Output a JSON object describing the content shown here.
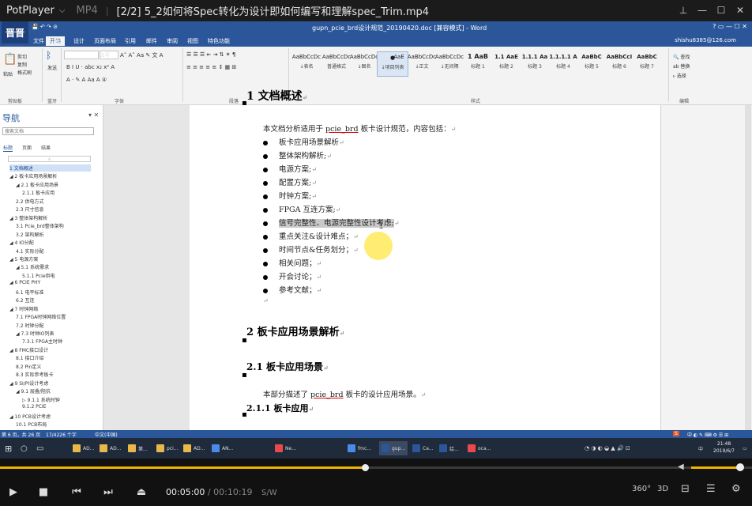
{
  "player": {
    "app_name": "PotPlayer",
    "format": "MP4",
    "file_title": "[2/2] 5_2如何将Spec转化为设计即如何编写和理解spec_Trim.mp4",
    "time_current": "00:05:00",
    "time_separator": "/",
    "time_total": "00:10:19",
    "speed_label": "S/W",
    "label_360": "360°",
    "label_3d": "3D",
    "progress_fraction": 0.485,
    "volume_fraction": 0.92
  },
  "word": {
    "logo": "晋晋",
    "doc_title": "gupn_pcie_brd设计规范_20190420.doc [兼容模式] - Word",
    "user": "shishu8385@126.com",
    "tabs": [
      "文件",
      "开始",
      "插入",
      "设计",
      "页面布局",
      "引用",
      "邮件",
      "审阅",
      "视图",
      "特色功能"
    ],
    "ribbon": {
      "paste": "粘贴",
      "cut": "剪切",
      "copy": "复制",
      "format_painter": "格式刷",
      "send": "发送",
      "font_size": "五号",
      "clipboard_group": "剪贴板",
      "blue_group": "蓝牙",
      "font_group": "字体",
      "para_group": "段落",
      "styles_group": "样式",
      "edit_group": "编辑",
      "find": "查找",
      "replace": "替换",
      "select": "选择",
      "styles": [
        {
          "preview": "AaBbCcDc",
          "name": "↓表名"
        },
        {
          "preview": "AaBbCcDc",
          "name": "普通格式"
        },
        {
          "preview": "AaBbCcDc",
          "name": "↓图名"
        },
        {
          "preview": "●",
          "name": "↓项目列表"
        },
        {
          "preview": "AaE",
          "name": ""
        },
        {
          "preview": "AaBbCcDc",
          "name": "↓正文"
        },
        {
          "preview": "AaBbCcDc",
          "name": "↓无间隔"
        },
        {
          "preview": "1 AaB",
          "name": "标题 1"
        },
        {
          "preview": "1.1 AaE",
          "name": "标题 2"
        },
        {
          "preview": "1.1.1 Aa",
          "name": "标题 3"
        },
        {
          "preview": "1.1.1.1 A",
          "name": "标题 4"
        },
        {
          "preview": "AaBbC",
          "name": "标题 5"
        },
        {
          "preview": "AaBbCcI",
          "name": "标题 6"
        },
        {
          "preview": "AaBbC",
          "name": "标题 7"
        }
      ]
    },
    "nav": {
      "title": "导航",
      "search_placeholder": "搜索文档",
      "tab_headings": "标题",
      "tab_pages": "页面",
      "tab_results": "结果",
      "items": [
        "1 文档概述",
        "◢ 2 板卡应用场景解析",
        "◢ 2.1 板卡应用场景",
        "2.1.1 板卡应用",
        "2.2 供电方式",
        "2.3 尺寸信息",
        "◢ 3 整体架构解析",
        "3.1 Pcie_brd整体架构",
        "3.2 架构解析",
        "◢ 4 IO分配",
        "4.1 实际分配",
        "◢ 5 电源方案",
        "◢ 5.1 系统需求",
        "5.1.1 Pcie供电",
        "◢ 6 PCIE PHY",
        "6.1 电平标准",
        "6.2 互连",
        "◢ 7 时钟网络",
        "7.1 FPGA时钟网络位置",
        "7.2 时钟分配",
        "◢ 7.3 时钟IO列表",
        "7.3.1 FPGA主时钟",
        "◢ 8 FMC接口设计",
        "8.1 接口介绍",
        "8.2 Pin定义",
        "8.3 实际参考板卡",
        "◢ 9 SI/PI设计考虑",
        "◢ 9.1 层叠/阻抗",
        "▷ 9.1.1 系统时钟",
        "9.1.2 PCIE",
        "◢ 10 PCB设计考虑",
        "10.1 PCB布局",
        "10.2 层叠",
        "10.3 设计规则"
      ]
    },
    "document": {
      "h1_overview": "1 文档概述",
      "intro_before": "本文档分析适用于 ",
      "intro_link": "pcie_brd",
      "intro_after": " 板卡设计规范，内容包括：",
      "bullets": [
        "板卡应用场景解析",
        "整体架构解析;",
        "电源方案;",
        "配置方案;",
        "时钟方案;",
        "FPGA 互连方案;",
        "信号完整性、电源完整性设计考虑;",
        "重点关注&设计难点；",
        "时间节点&任务划分；",
        "相关问题；",
        "开会讨论；",
        "参考文献；"
      ],
      "h1_scene": "2 板卡应用场景解析",
      "h2_scene": "2.1 板卡应用场景",
      "para_scene_before": "本部分描述了 ",
      "para_scene_link": "pcie_brd",
      "para_scene_after": " 板卡的设计应用场景。",
      "h3_app": "2.1.1 板卡应用"
    },
    "status": {
      "page": "第 6 页，共 26 页",
      "words": "17/4226 个字",
      "lang": "中文(中国)"
    }
  },
  "taskbar": {
    "items": [
      "AD...",
      "AD...",
      "第...",
      "pci...",
      "AD...",
      "AN...",
      "Ne...",
      "fmc...",
      "gup...",
      "Ca...",
      "绘...",
      "oca..."
    ],
    "time": "21:48",
    "date": "2019/6/7",
    "ime": "中"
  },
  "colors": {
    "word_blue": "#2b579a",
    "seek_fill": "#f0b400",
    "highlight": "#c9c9c9"
  }
}
